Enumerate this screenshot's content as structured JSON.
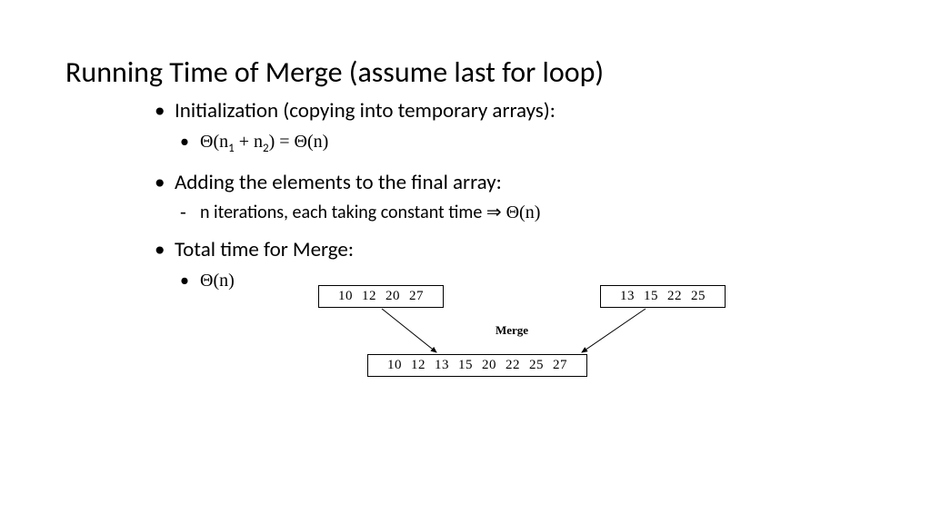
{
  "title": "Running Time of Merge (assume last for loop)",
  "bullets": {
    "b1": "Initialization (copying into temporary arrays):",
    "b1a_pre": "Θ(n",
    "b1a_mid1": " + n",
    "b1a_mid2": ") = Θ(n)",
    "b2": "Adding the elements to the final array:",
    "b2a_pre": "n ",
    "b2a_txt": "iterations, each taking constant time ",
    "b2a_arrow": "⇒",
    "b2a_end": " Θ(n)",
    "b3": "Total time for Merge:",
    "b3a": "Θ(n)"
  },
  "sub1": "1",
  "sub2": "2",
  "merge_label": "Merge",
  "arrays": {
    "left": [
      "10",
      "12",
      "20",
      "27"
    ],
    "right": [
      "13",
      "15",
      "22",
      "25"
    ],
    "merged": [
      "10",
      "12",
      "13",
      "15",
      "20",
      "22",
      "25",
      "27"
    ]
  }
}
